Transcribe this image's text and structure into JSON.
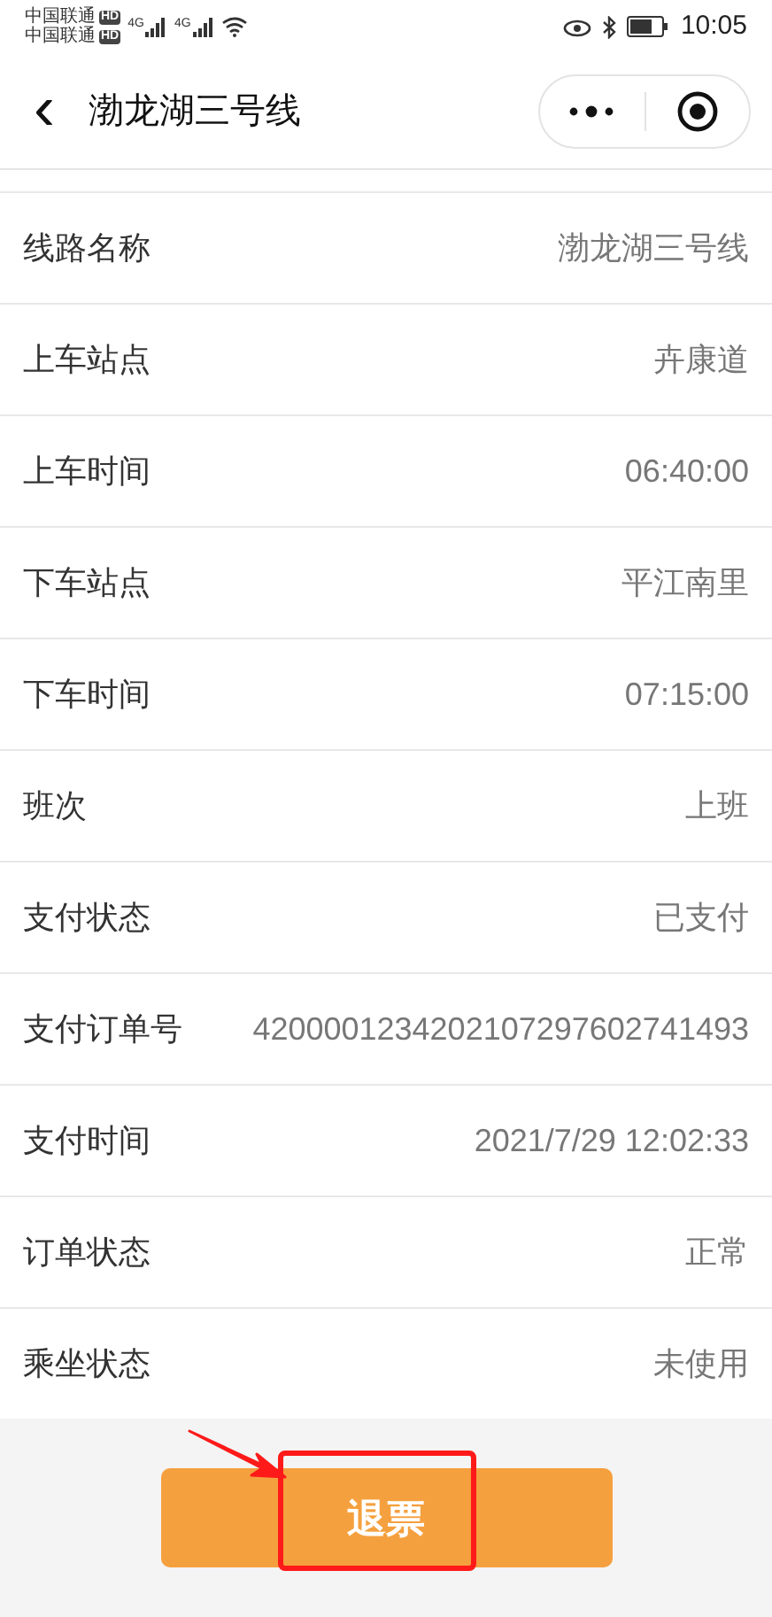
{
  "status_bar": {
    "carriers": [
      {
        "name": "中国联通",
        "badge": "HD"
      },
      {
        "name": "中国联通",
        "badge": "HD"
      }
    ],
    "network_labels": [
      "4G",
      "4G"
    ],
    "time": "10:05"
  },
  "nav": {
    "back": "‹",
    "title": "渤龙湖三号线"
  },
  "details": [
    {
      "label": "线路名称",
      "value": "渤龙湖三号线"
    },
    {
      "label": "上车站点",
      "value": "卉康道"
    },
    {
      "label": "上车时间",
      "value": "06:40:00"
    },
    {
      "label": "下车站点",
      "value": "平江南里"
    },
    {
      "label": "下车时间",
      "value": "07:15:00"
    },
    {
      "label": "班次",
      "value": "上班"
    },
    {
      "label": "支付状态",
      "value": "已支付"
    },
    {
      "label": "支付订单号",
      "value": "4200001234202107297602741493"
    },
    {
      "label": "支付时间",
      "value": "2021/7/29 12:02:33"
    },
    {
      "label": "订单状态",
      "value": "正常"
    },
    {
      "label": "乘坐状态",
      "value": "未使用"
    }
  ],
  "refund_button": {
    "label": "退票",
    "highlighted": true
  }
}
